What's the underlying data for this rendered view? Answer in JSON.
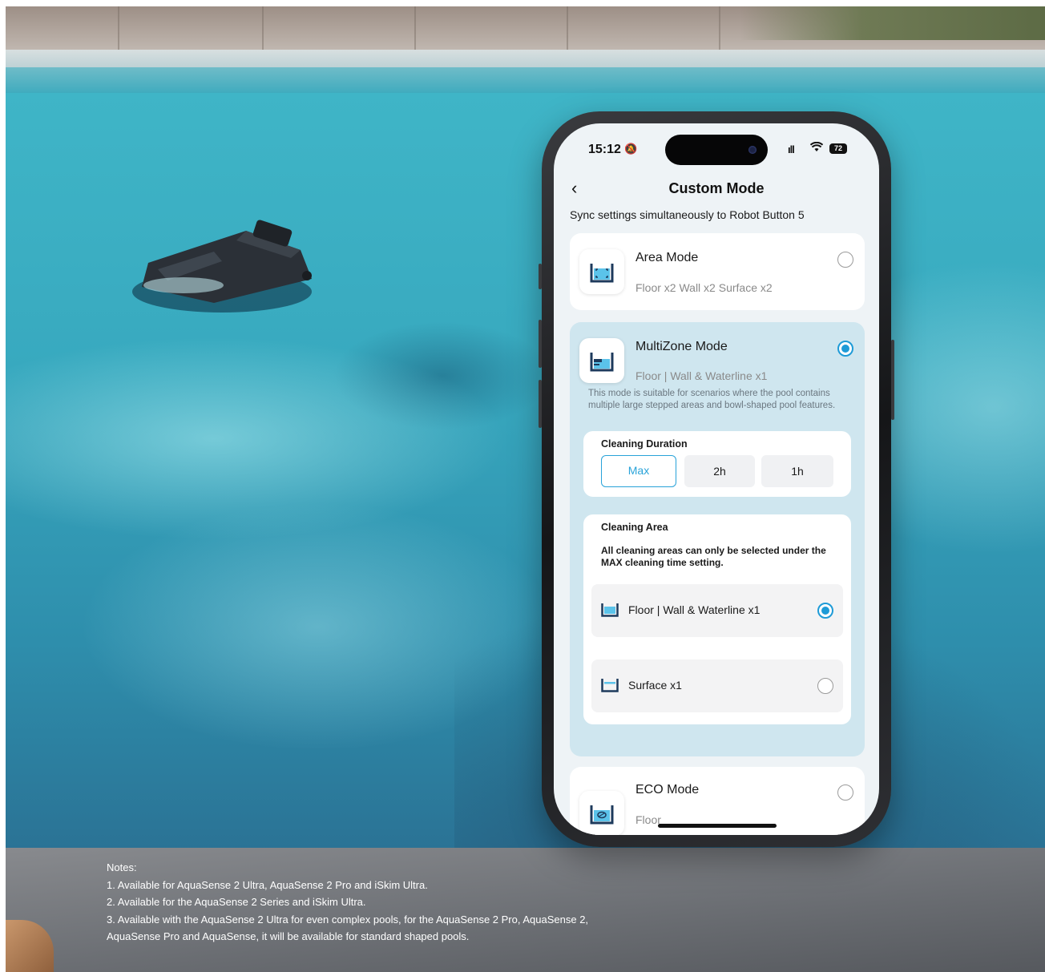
{
  "status_bar": {
    "time": "15:12",
    "battery": "72"
  },
  "nav": {
    "back_label": "‹",
    "title": "Custom Mode"
  },
  "sync_text": "Sync settings simultaneously to Robot Button 5",
  "modes": [
    {
      "name": "Area Mode",
      "desc": "Floor x2 Wall x2 Surface x2",
      "selected": false,
      "icon": "area-mode-icon"
    },
    {
      "name": "MultiZone Mode",
      "desc": "Floor | Wall & Waterline x1",
      "selected": true,
      "icon": "multizone-mode-icon",
      "note": "This mode is suitable for scenarios where the pool contains multiple large stepped areas and bowl-shaped pool features."
    },
    {
      "name": "ECO Mode",
      "desc": "Floor",
      "selected": false,
      "icon": "eco-mode-icon"
    }
  ],
  "cleaning_duration": {
    "title": "Cleaning Duration",
    "options": [
      "Max",
      "2h",
      "1h"
    ],
    "selected": "Max"
  },
  "cleaning_area": {
    "title": "Cleaning Area",
    "note": "All cleaning areas can only be selected under the MAX cleaning time setting.",
    "options": [
      {
        "label": "Floor | Wall & Waterline x1",
        "selected": true
      },
      {
        "label": "Surface x1",
        "selected": false
      }
    ]
  },
  "notes": {
    "heading": "Notes:",
    "lines": [
      "1. Available for AquaSense 2 Ultra, AquaSense 2 Pro and iSkim Ultra.",
      "2. Available for the AquaSense 2 Series and iSkim Ultra.",
      "3. Available with the AquaSense 2 Ultra for even complex pools, for the AquaSense 2 Pro, AquaSense 2,",
      "AquaSense Pro and AquaSense, it will be available for standard shaped pools."
    ]
  },
  "colors": {
    "accent": "#1e9bd7",
    "selected_card": "#cfe6ef",
    "water": "#38a9bf"
  }
}
